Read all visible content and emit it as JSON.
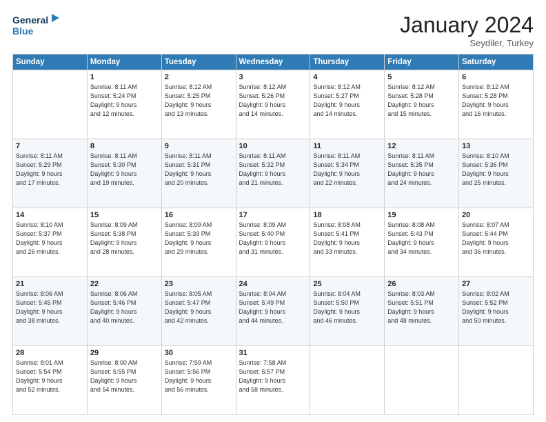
{
  "logo": {
    "line1": "General",
    "line2": "Blue"
  },
  "title": "January 2024",
  "subtitle": "Seydiler, Turkey",
  "header_days": [
    "Sunday",
    "Monday",
    "Tuesday",
    "Wednesday",
    "Thursday",
    "Friday",
    "Saturday"
  ],
  "weeks": [
    [
      {
        "day": "",
        "sunrise": "",
        "sunset": "",
        "daylight": ""
      },
      {
        "day": "1",
        "sunrise": "Sunrise: 8:11 AM",
        "sunset": "Sunset: 5:24 PM",
        "daylight": "Daylight: 9 hours and 12 minutes."
      },
      {
        "day": "2",
        "sunrise": "Sunrise: 8:12 AM",
        "sunset": "Sunset: 5:25 PM",
        "daylight": "Daylight: 9 hours and 13 minutes."
      },
      {
        "day": "3",
        "sunrise": "Sunrise: 8:12 AM",
        "sunset": "Sunset: 5:26 PM",
        "daylight": "Daylight: 9 hours and 14 minutes."
      },
      {
        "day": "4",
        "sunrise": "Sunrise: 8:12 AM",
        "sunset": "Sunset: 5:27 PM",
        "daylight": "Daylight: 9 hours and 14 minutes."
      },
      {
        "day": "5",
        "sunrise": "Sunrise: 8:12 AM",
        "sunset": "Sunset: 5:28 PM",
        "daylight": "Daylight: 9 hours and 15 minutes."
      },
      {
        "day": "6",
        "sunrise": "Sunrise: 8:12 AM",
        "sunset": "Sunset: 5:28 PM",
        "daylight": "Daylight: 9 hours and 16 minutes."
      }
    ],
    [
      {
        "day": "7",
        "sunrise": "Sunrise: 8:11 AM",
        "sunset": "Sunset: 5:29 PM",
        "daylight": "Daylight: 9 hours and 17 minutes."
      },
      {
        "day": "8",
        "sunrise": "Sunrise: 8:11 AM",
        "sunset": "Sunset: 5:30 PM",
        "daylight": "Daylight: 9 hours and 19 minutes."
      },
      {
        "day": "9",
        "sunrise": "Sunrise: 8:11 AM",
        "sunset": "Sunset: 5:31 PM",
        "daylight": "Daylight: 9 hours and 20 minutes."
      },
      {
        "day": "10",
        "sunrise": "Sunrise: 8:11 AM",
        "sunset": "Sunset: 5:32 PM",
        "daylight": "Daylight: 9 hours and 21 minutes."
      },
      {
        "day": "11",
        "sunrise": "Sunrise: 8:11 AM",
        "sunset": "Sunset: 5:34 PM",
        "daylight": "Daylight: 9 hours and 22 minutes."
      },
      {
        "day": "12",
        "sunrise": "Sunrise: 8:11 AM",
        "sunset": "Sunset: 5:35 PM",
        "daylight": "Daylight: 9 hours and 24 minutes."
      },
      {
        "day": "13",
        "sunrise": "Sunrise: 8:10 AM",
        "sunset": "Sunset: 5:36 PM",
        "daylight": "Daylight: 9 hours and 25 minutes."
      }
    ],
    [
      {
        "day": "14",
        "sunrise": "Sunrise: 8:10 AM",
        "sunset": "Sunset: 5:37 PM",
        "daylight": "Daylight: 9 hours and 26 minutes."
      },
      {
        "day": "15",
        "sunrise": "Sunrise: 8:09 AM",
        "sunset": "Sunset: 5:38 PM",
        "daylight": "Daylight: 9 hours and 28 minutes."
      },
      {
        "day": "16",
        "sunrise": "Sunrise: 8:09 AM",
        "sunset": "Sunset: 5:39 PM",
        "daylight": "Daylight: 9 hours and 29 minutes."
      },
      {
        "day": "17",
        "sunrise": "Sunrise: 8:09 AM",
        "sunset": "Sunset: 5:40 PM",
        "daylight": "Daylight: 9 hours and 31 minutes."
      },
      {
        "day": "18",
        "sunrise": "Sunrise: 8:08 AM",
        "sunset": "Sunset: 5:41 PM",
        "daylight": "Daylight: 9 hours and 33 minutes."
      },
      {
        "day": "19",
        "sunrise": "Sunrise: 8:08 AM",
        "sunset": "Sunset: 5:43 PM",
        "daylight": "Daylight: 9 hours and 34 minutes."
      },
      {
        "day": "20",
        "sunrise": "Sunrise: 8:07 AM",
        "sunset": "Sunset: 5:44 PM",
        "daylight": "Daylight: 9 hours and 36 minutes."
      }
    ],
    [
      {
        "day": "21",
        "sunrise": "Sunrise: 8:06 AM",
        "sunset": "Sunset: 5:45 PM",
        "daylight": "Daylight: 9 hours and 38 minutes."
      },
      {
        "day": "22",
        "sunrise": "Sunrise: 8:06 AM",
        "sunset": "Sunset: 5:46 PM",
        "daylight": "Daylight: 9 hours and 40 minutes."
      },
      {
        "day": "23",
        "sunrise": "Sunrise: 8:05 AM",
        "sunset": "Sunset: 5:47 PM",
        "daylight": "Daylight: 9 hours and 42 minutes."
      },
      {
        "day": "24",
        "sunrise": "Sunrise: 8:04 AM",
        "sunset": "Sunset: 5:49 PM",
        "daylight": "Daylight: 9 hours and 44 minutes."
      },
      {
        "day": "25",
        "sunrise": "Sunrise: 8:04 AM",
        "sunset": "Sunset: 5:50 PM",
        "daylight": "Daylight: 9 hours and 46 minutes."
      },
      {
        "day": "26",
        "sunrise": "Sunrise: 8:03 AM",
        "sunset": "Sunset: 5:51 PM",
        "daylight": "Daylight: 9 hours and 48 minutes."
      },
      {
        "day": "27",
        "sunrise": "Sunrise: 8:02 AM",
        "sunset": "Sunset: 5:52 PM",
        "daylight": "Daylight: 9 hours and 50 minutes."
      }
    ],
    [
      {
        "day": "28",
        "sunrise": "Sunrise: 8:01 AM",
        "sunset": "Sunset: 5:54 PM",
        "daylight": "Daylight: 9 hours and 52 minutes."
      },
      {
        "day": "29",
        "sunrise": "Sunrise: 8:00 AM",
        "sunset": "Sunset: 5:55 PM",
        "daylight": "Daylight: 9 hours and 54 minutes."
      },
      {
        "day": "30",
        "sunrise": "Sunrise: 7:59 AM",
        "sunset": "Sunset: 5:56 PM",
        "daylight": "Daylight: 9 hours and 56 minutes."
      },
      {
        "day": "31",
        "sunrise": "Sunrise: 7:58 AM",
        "sunset": "Sunset: 5:57 PM",
        "daylight": "Daylight: 9 hours and 58 minutes."
      },
      {
        "day": "",
        "sunrise": "",
        "sunset": "",
        "daylight": ""
      },
      {
        "day": "",
        "sunrise": "",
        "sunset": "",
        "daylight": ""
      },
      {
        "day": "",
        "sunrise": "",
        "sunset": "",
        "daylight": ""
      }
    ]
  ]
}
